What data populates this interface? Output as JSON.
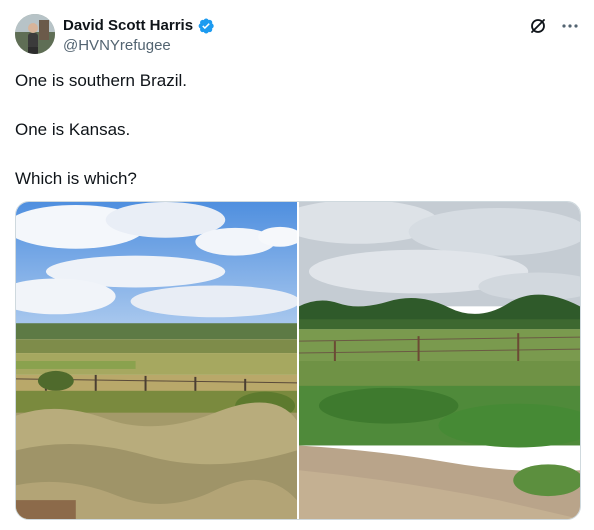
{
  "author": {
    "display_name": "David Scott Harris",
    "handle": "@HVNYrefugee",
    "verified": true
  },
  "icons": {
    "verified": "verified-badge-icon",
    "grok": "grok-icon",
    "more": "more-icon"
  },
  "tweet": {
    "lines": [
      "One is southern Brazil.",
      "One is Kansas.",
      "Which is which?"
    ]
  },
  "colors": {
    "verified_blue": "#1d9bf0",
    "text": "#0f1419",
    "secondary": "#536471"
  }
}
